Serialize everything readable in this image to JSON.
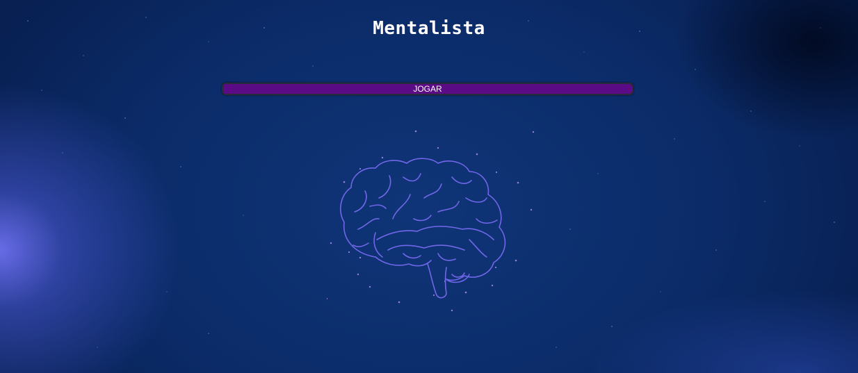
{
  "page": {
    "title": "Mentalista"
  },
  "actions": {
    "play_label": "JOGAR"
  },
  "illustration": {
    "icon": "brain-icon"
  },
  "colors": {
    "background": "#0b2b68",
    "button": "#5a0b85",
    "brain_stroke": "#6f63e8",
    "title_text": "#ffffff"
  }
}
